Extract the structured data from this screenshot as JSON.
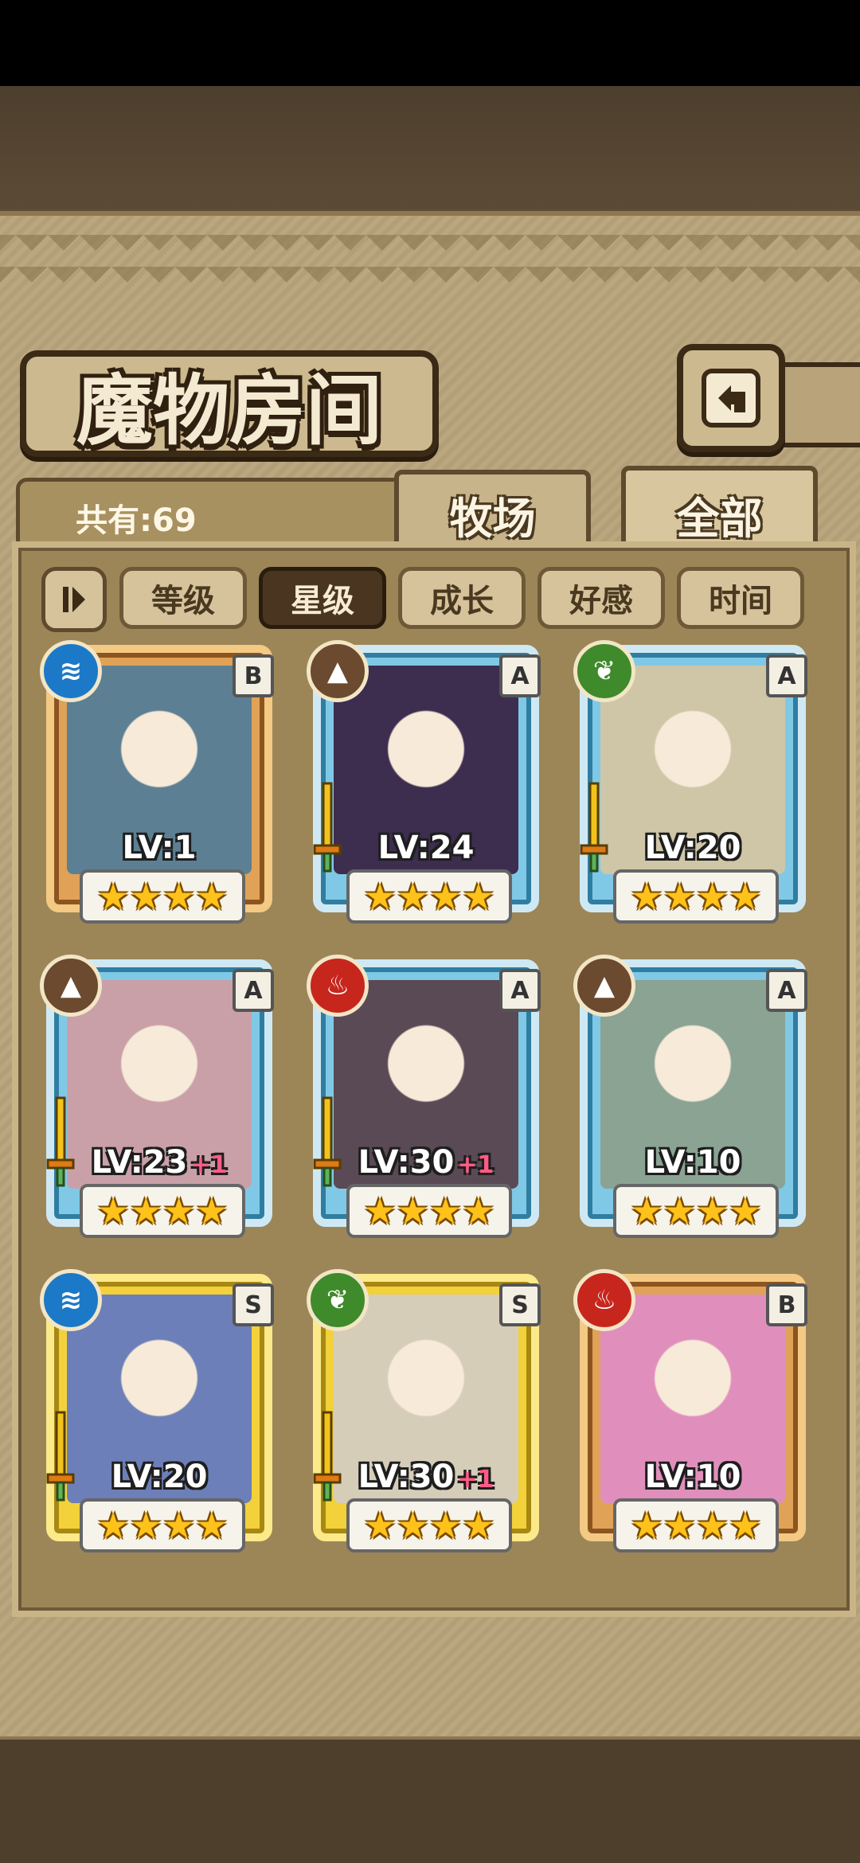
{
  "header": {
    "title": "魔物房间",
    "back_icon": "back-arrow-icon"
  },
  "summary": {
    "count_label": "共有:69"
  },
  "tabs": [
    {
      "label": "牧场",
      "active": false
    },
    {
      "label": "全部",
      "active": true
    }
  ],
  "sort": {
    "toggle_icon": "order-toggle-icon",
    "buttons": [
      {
        "label": "等级",
        "active": false
      },
      {
        "label": "星级",
        "active": true
      },
      {
        "label": "成长",
        "active": false
      },
      {
        "label": "好感",
        "active": false
      },
      {
        "label": "时间",
        "active": false
      }
    ]
  },
  "colors": {
    "water": "#1c79c8",
    "earth": "#6b4a30",
    "plant": "#3f8a2a",
    "fire": "#c7261d"
  },
  "cards": [
    {
      "attribute": "water-icon",
      "rank": "B",
      "level": "LV:1",
      "plus": "",
      "stars": 4,
      "weapon": false,
      "art_color": "#5d7f93"
    },
    {
      "attribute": "earth-icon",
      "rank": "A",
      "level": "LV:24",
      "plus": "",
      "stars": 4,
      "weapon": true,
      "art_color": "#3d2d4f"
    },
    {
      "attribute": "plant-icon",
      "rank": "A",
      "level": "LV:20",
      "plus": "",
      "stars": 4,
      "weapon": true,
      "art_color": "#cfc6a8"
    },
    {
      "attribute": "earth-icon",
      "rank": "A",
      "level": "LV:23",
      "plus": "+1",
      "stars": 4,
      "weapon": true,
      "art_color": "#c9a0a8"
    },
    {
      "attribute": "fire-icon",
      "rank": "A",
      "level": "LV:30",
      "plus": "+1",
      "stars": 4,
      "weapon": true,
      "art_color": "#5a4a55"
    },
    {
      "attribute": "earth-icon",
      "rank": "A",
      "level": "LV:10",
      "plus": "",
      "stars": 4,
      "weapon": false,
      "art_color": "#8aa392"
    },
    {
      "attribute": "water-icon",
      "rank": "S",
      "level": "LV:20",
      "plus": "",
      "stars": 4,
      "weapon": true,
      "art_color": "#6d7fb8"
    },
    {
      "attribute": "plant-icon",
      "rank": "S",
      "level": "LV:30",
      "plus": "+1",
      "stars": 4,
      "weapon": true,
      "art_color": "#d6cdb9"
    },
    {
      "attribute": "fire-icon",
      "rank": "B",
      "level": "LV:10",
      "plus": "",
      "stars": 4,
      "weapon": false,
      "art_color": "#e08fbd"
    }
  ]
}
